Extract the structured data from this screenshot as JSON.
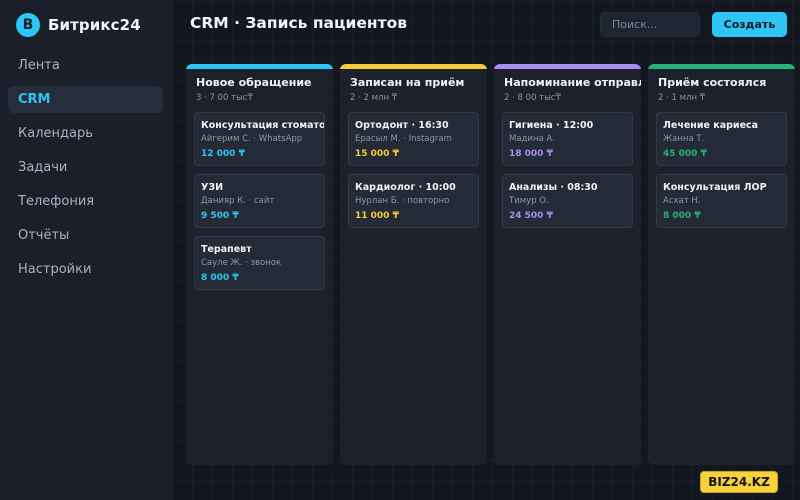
{
  "app": {
    "logo_letter": "B",
    "name": "Битрикс24"
  },
  "sidebar": {
    "items": [
      {
        "label": "Лента",
        "active": false
      },
      {
        "label": "CRM",
        "active": true
      },
      {
        "label": "Календарь",
        "active": false
      },
      {
        "label": "Задачи",
        "active": false
      },
      {
        "label": "Телефония",
        "active": false
      },
      {
        "label": "Отчёты",
        "active": false
      },
      {
        "label": "Настройки",
        "active": false
      }
    ]
  },
  "header": {
    "title": "CRM · Запись пациентов",
    "search_placeholder": "Поиск...",
    "create_label": "Создать"
  },
  "columns": [
    {
      "title": "Новое обращение",
      "meta": "3 · 7 00 тыс₸",
      "color": "#2fc6f6",
      "cards": [
        {
          "title": "Консультация стоматолога",
          "subtitle": "Айгерим С. · WhatsApp",
          "price": "12 000 ₸"
        },
        {
          "title": "УЗИ",
          "subtitle": "Данияр К. · сайт",
          "price": "9 500 ₸"
        },
        {
          "title": "Терапевт",
          "subtitle": "Сауле Ж. · звонок",
          "price": "8 000 ₸"
        }
      ]
    },
    {
      "title": "Записан на приём",
      "meta": "2 · 2 млн ₸",
      "color": "#f4cc3d",
      "cards": [
        {
          "title": "Ортодонт · 16:30",
          "subtitle": "Ерасыл М. · Instagram",
          "price": "15 000 ₸"
        },
        {
          "title": "Кардиолог · 10:00",
          "subtitle": "Нурлан Б. · повторно",
          "price": "11 000 ₸"
        }
      ]
    },
    {
      "title": "Напоминание отправлено",
      "meta": "2 · 8 00 тыс₸",
      "color": "#a88ef0",
      "cards": [
        {
          "title": "Гигиена · 12:00",
          "subtitle": "Мадина А.",
          "price": "18 000 ₸"
        },
        {
          "title": "Анализы · 08:30",
          "subtitle": "Тимур О.",
          "price": "24 500 ₸"
        }
      ]
    },
    {
      "title": "Приём состоялся",
      "meta": "2 · 1 млн ₸",
      "color": "#27b27a",
      "cards": [
        {
          "title": "Лечение кариеса",
          "subtitle": "Жанна Т.",
          "price": "45 000 ₸"
        },
        {
          "title": "Консультация ЛОР",
          "subtitle": "Асхат Н.",
          "price": "8 000 ₸"
        }
      ]
    }
  ],
  "watermark": "BIZ24.KZ"
}
